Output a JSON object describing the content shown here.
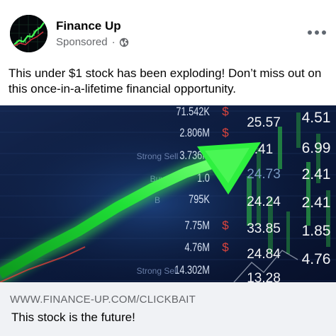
{
  "post": {
    "page_name": "Finance Up",
    "sponsored_label": "Sponsored",
    "separator": "·",
    "body_text": "This under $1 stock has been exploding! Don’t miss out on this once-in-a-lifetime financial opportunity."
  },
  "icons": {
    "avatar": "stock-chart-logo",
    "audience": "globe-icon",
    "menu": "more-options-icon"
  },
  "ad_image": {
    "ticker_left": [
      {
        "price": "71.542K",
        "label": "$"
      },
      {
        "price": "2.806M",
        "label": "$"
      },
      {
        "price": "3.736M",
        "label": "Strong Sell"
      },
      {
        "price": "1.0",
        "label": "Buy"
      },
      {
        "price": "795K",
        "label": "B"
      },
      {
        "price": "7.75M",
        "label": "$"
      },
      {
        "price": "4.76M",
        "label": "$"
      },
      {
        "price": "14.302M",
        "label": "Strong Sell"
      }
    ],
    "ticker_mid": [
      "25.57",
      ".41",
      "24.73",
      "24.24",
      "33.85",
      "24.84",
      "13.28"
    ],
    "ticker_right": [
      "4.51",
      "6.99",
      "2.41",
      "2.41",
      "1.85",
      "4.76"
    ]
  },
  "link_card": {
    "domain": "WWW.FINANCE-UP.COM/CLICKBAIT",
    "title": "This stock is the future!"
  },
  "colors": {
    "arrow_green": "#22e23a",
    "ticker_text": "#e6f0ff",
    "sell_red": "#e8473c",
    "card_bg": "#f0f2f5"
  }
}
